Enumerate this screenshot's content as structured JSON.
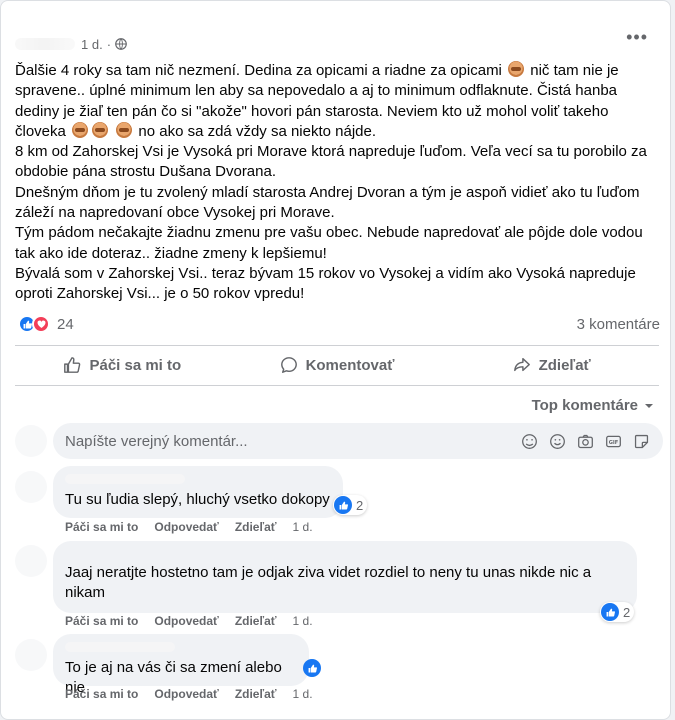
{
  "post": {
    "time": "1 d.",
    "privacy_dot": "·",
    "paragraphs": [
      "Ďalšie 4 roky sa tam nič nezmení. Dedina za opicami  a riadne za opicami",
      "nič tam nie je spravene.. úplné minimum len aby sa nepovedalo a aj to minimum odflaknute. Čistá hanba dediny je žiaľ ten pán čo si \"akože\" hovori pán starosta. Neviem kto už mohol voliť takeho človeka",
      "no ako sa zdá vždy sa niekto nájde.",
      " 8 km od Zahorskej Vsi je Vysoká pri Morave ktorá napreduje ľuďom. Veľa vecí sa tu porobilo za obdobie pána strostu Dušana Dvorana.",
      "Dnešným dňom je tu zvolený mladí starosta Andrej Dvoran a tým je aspoň vidieť ako tu ľuďom záleží na napredovaní obce Vysokej pri Morave.",
      "Tým pádom nečakajte žiadnu zmenu pre vašu obec. Nebude napredovať ale pôjde dole vodou tak ako ide doteraz.. žiadne zmeny k lepšiemu!",
      "Bývalá som v Zahorskej Vsi.. teraz bývam 15 rokov vo Vysokej a vidím ako Vysoká napreduje oproti Zahorskej Vsi... je o 50 rokov vpredu!"
    ],
    "reaction_count": "24",
    "comments_count": "3 komentáre"
  },
  "actions": {
    "like": "Páči sa mi to",
    "comment": "Komentovať",
    "share": "Zdieľať"
  },
  "comments_filter": "Top komentáre",
  "composer": {
    "placeholder": "Napíšte verejný komentár..."
  },
  "comments": [
    {
      "text": "Tu su ľudia slepý, hluchý vsetko dokopy",
      "likes": "2",
      "like": "Páči sa mi to",
      "reply": "Odpovedať",
      "share": "Zdieľať",
      "time": "1 d."
    },
    {
      "text": "Jaaj neratjte hostetno tam je odjak ziva videt rozdiel to neny tu unas nikde nic a nikam",
      "likes": "2",
      "like": "Páči sa mi to",
      "reply": "Odpovedať",
      "share": "Zdieľať",
      "time": "1 d."
    },
    {
      "text": "To je aj na vás či sa zmení alebo nie",
      "likes": "",
      "like": "Páči sa mi to",
      "reply": "Odpovedať",
      "share": "Zdieľať",
      "time": "1 d."
    }
  ],
  "colors": {
    "accent": "#1877f2",
    "love": "#f33e58",
    "muted": "#65676b",
    "bubble": "#f0f2f5"
  },
  "icons": [
    "globe-icon",
    "more-icon",
    "like-icon",
    "love-icon",
    "comment-icon",
    "share-icon",
    "chevron-down-icon",
    "sticker-icon",
    "emoji-icon",
    "camera-icon",
    "gif-icon",
    "avatar-sticker-icon",
    "monkey-emoji-icon"
  ]
}
